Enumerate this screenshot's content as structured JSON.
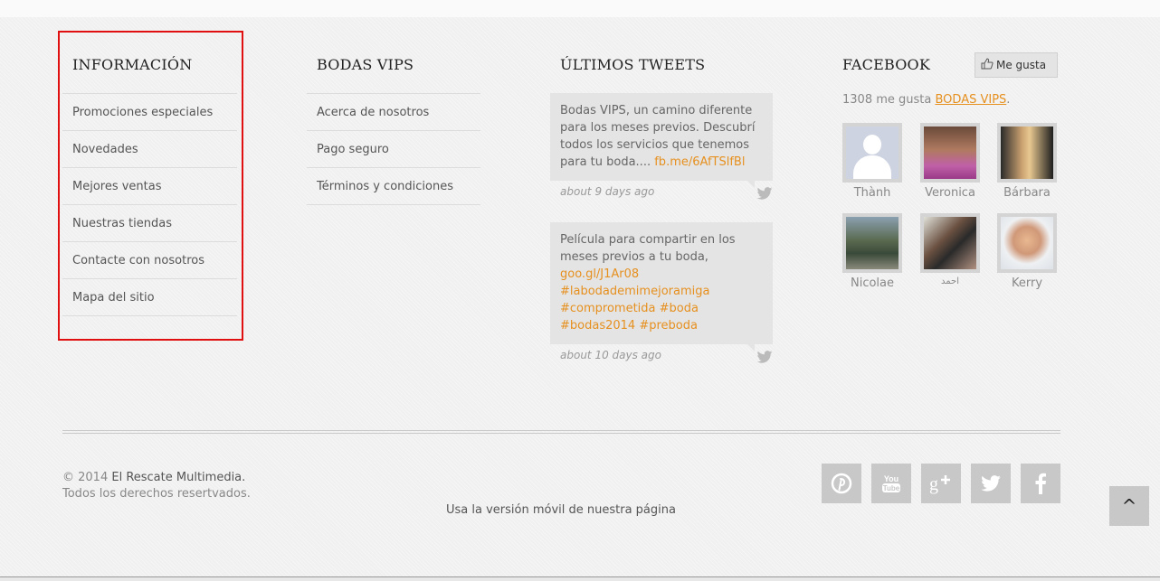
{
  "info": {
    "title": "INFORMACIÓN",
    "items": [
      "Promociones especiales",
      "Novedades",
      "Mejores ventas",
      "Nuestras tiendas",
      "Contacte con nosotros",
      "Mapa del sitio"
    ]
  },
  "bodas": {
    "title": "BODAS VIPS",
    "items": [
      "Acerca de nosotros",
      "Pago seguro",
      "Términos y condiciones"
    ]
  },
  "tweets": {
    "title": "ÚLTIMOS TWEETS",
    "list": [
      {
        "text": "Bodas VIPS, un camino diferente para los meses previos. Descubrí todos los servicios que tenemos para tu boda....",
        "link": "fb.me/6AfTSlfBl",
        "time": "about 9 days ago"
      },
      {
        "text": "Película para compartir en los meses previos a tu boda,",
        "link": "goo.gl/J1Ar08",
        "tags": [
          "#labodademimejoramiga",
          "#comprometida",
          "#boda",
          "#bodas2014",
          "#preboda"
        ],
        "time": "about 10 days ago"
      }
    ]
  },
  "facebook": {
    "title": "FACEBOOK",
    "like_label": "Me gusta",
    "count_text": "1308 me gusta",
    "brand": "BODAS VIPS",
    "fans": [
      "Thành",
      "Veronica",
      "Bárbara",
      "Nicolae",
      "احمد",
      "Kerry"
    ]
  },
  "footer": {
    "copyright_prefix": "© 2014",
    "owner": "El Rescate Multimedia.",
    "rights": "Todos los derechos resertvados.",
    "mobile": "Usa la versión móvil de nuestra página",
    "social": [
      "pinterest-icon",
      "youtube-icon",
      "google-plus-icon",
      "twitter-icon",
      "facebook-icon"
    ],
    "to_top": "^"
  },
  "colors": {
    "accent": "#e6901f",
    "highlight": "#e01010"
  }
}
